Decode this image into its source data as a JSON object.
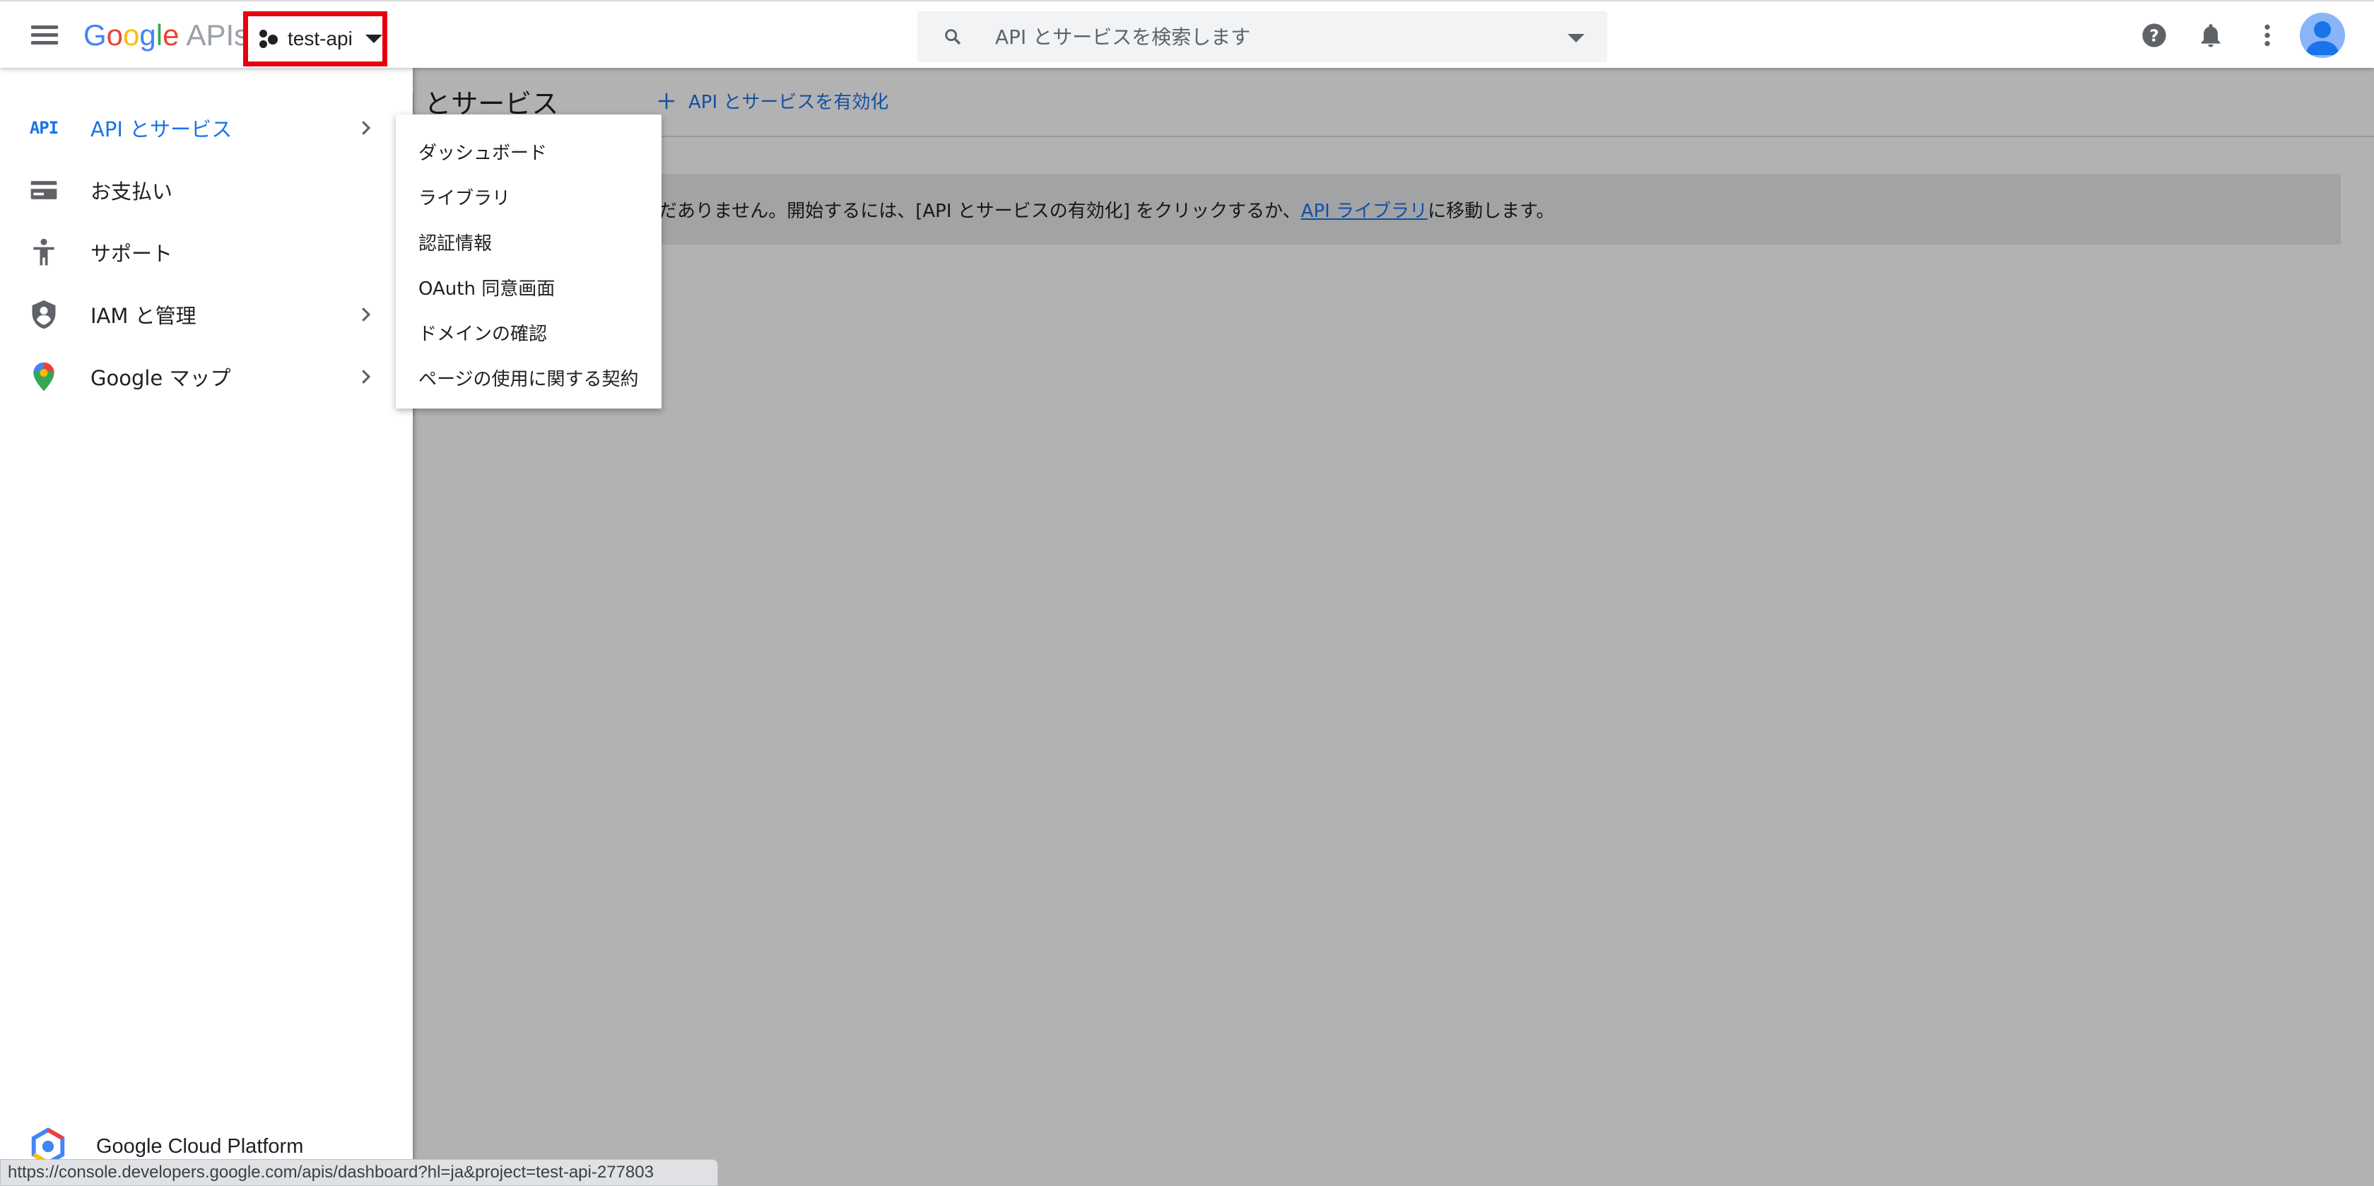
{
  "header": {
    "logo": {
      "g1": "G",
      "o1": "o",
      "o2": "o",
      "g2": "g",
      "l": "l",
      "e": "e",
      "apis": "APIs"
    },
    "project_name": "test-api",
    "search_placeholder": "API とサービスを検索します"
  },
  "page": {
    "title": "PI とサービス",
    "enable_button_label": "API とサービスを有効化",
    "info_text_prefix": "だありません。開始するには、[API とサービスの有効化] をクリックするか、",
    "info_link_text": "API ライブラリ",
    "info_text_suffix": "に移動します。"
  },
  "sidebar": {
    "items": [
      {
        "label": "API とサービス",
        "icon_text": "API",
        "icon": "api-icon",
        "has_submenu": true,
        "active": true
      },
      {
        "label": "お支払い",
        "icon": "billing-icon",
        "has_submenu": false
      },
      {
        "label": "サポート",
        "icon": "support-icon",
        "has_submenu": false
      },
      {
        "label": "IAM と管理",
        "icon": "shield-icon",
        "has_submenu": true
      },
      {
        "label": "Google マップ",
        "icon": "map-pin-icon",
        "has_submenu": true
      }
    ],
    "footer_label": "Google Cloud Platform"
  },
  "submenu": {
    "items": [
      "ダッシュボード",
      "ライブラリ",
      "認証情報",
      "OAuth 同意画面",
      "ドメインの確認",
      "ページの使用に関する契約"
    ]
  },
  "statusbar": {
    "url": "https://console.developers.google.com/apis/dashboard?hl=ja&project=test-api-277803"
  },
  "colors": {
    "accent": "#1a73e8",
    "highlight_border": "#e60012",
    "icon_gray": "#5f6368"
  }
}
